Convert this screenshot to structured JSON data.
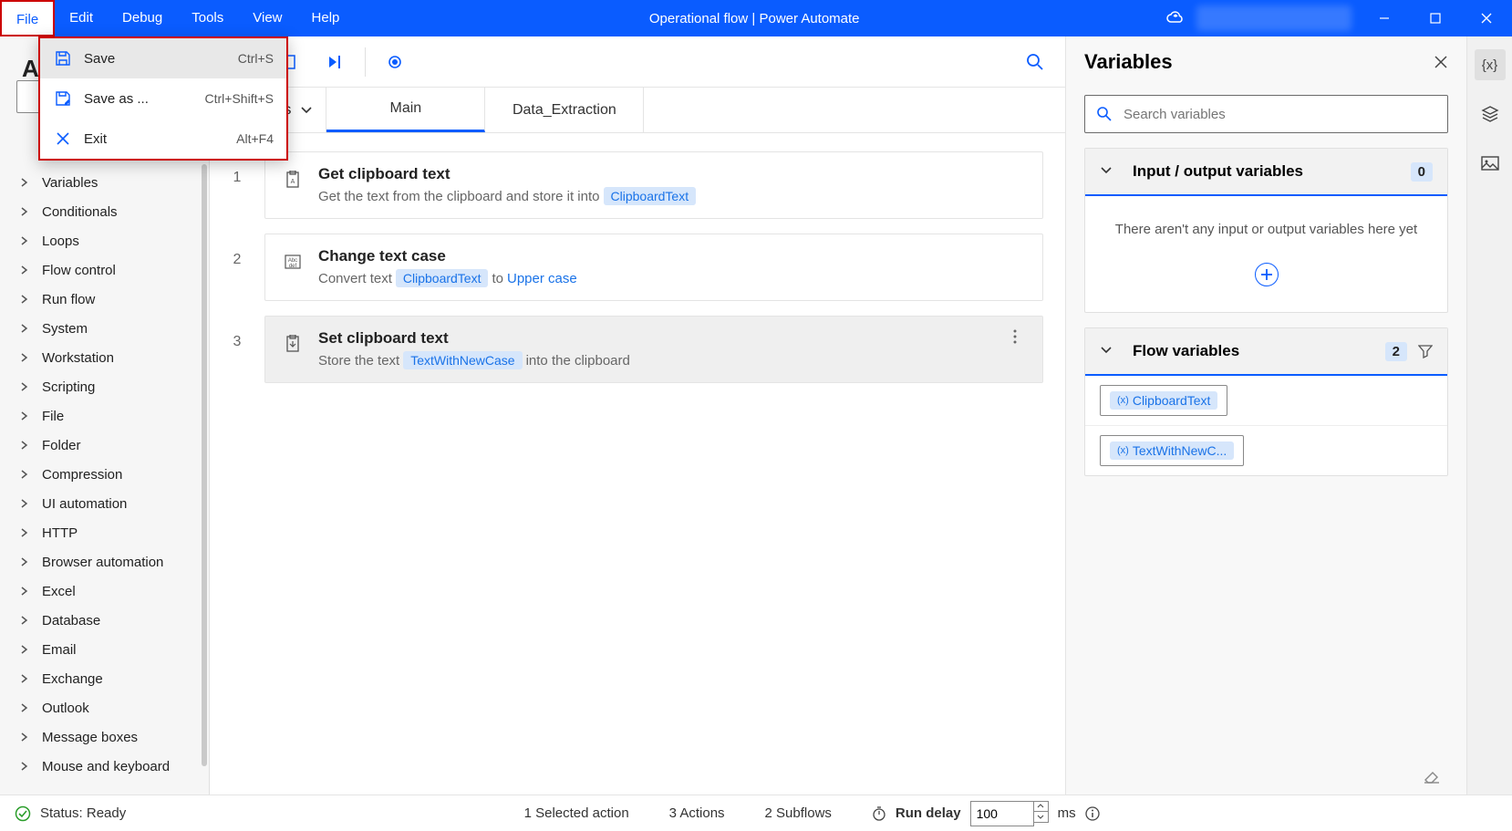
{
  "titlebar": {
    "menu": [
      "File",
      "Edit",
      "Debug",
      "Tools",
      "View",
      "Help"
    ],
    "title": "Operational flow | Power Automate"
  },
  "file_menu": {
    "items": [
      {
        "label": "Save",
        "shortcut": "Ctrl+S",
        "hover": true
      },
      {
        "label": "Save as ...",
        "shortcut": "Ctrl+Shift+S",
        "hover": false
      },
      {
        "label": "Exit",
        "shortcut": "Alt+F4",
        "hover": false
      }
    ]
  },
  "actions_pane": {
    "header_partial": "A",
    "tree": [
      "Variables",
      "Conditionals",
      "Loops",
      "Flow control",
      "Run flow",
      "System",
      "Workstation",
      "Scripting",
      "File",
      "Folder",
      "Compression",
      "UI automation",
      "HTTP",
      "Browser automation",
      "Excel",
      "Database",
      "Email",
      "Exchange",
      "Outlook",
      "Message boxes",
      "Mouse and keyboard"
    ]
  },
  "tabs": {
    "subflows_label": "bflows",
    "items": [
      "Main",
      "Data_Extraction"
    ],
    "active": 0
  },
  "steps": [
    {
      "title": "Get clipboard text",
      "desc_prefix": "Get the text from the clipboard and store it into",
      "var": "ClipboardText"
    },
    {
      "title": "Change text case",
      "desc_prefix": "Convert text",
      "var": "ClipboardText",
      "mid": "to",
      "link": "Upper case"
    },
    {
      "title": "Set clipboard text",
      "desc_prefix": "Store the text",
      "var": "TextWithNewCase",
      "suffix": "into the clipboard",
      "selected": true
    }
  ],
  "variables_pane": {
    "title": "Variables",
    "search_placeholder": "Search variables",
    "io_section": {
      "label": "Input / output variables",
      "count": "0",
      "empty": "There aren't any input or output variables here yet"
    },
    "flow_section": {
      "label": "Flow variables",
      "count": "2",
      "vars": [
        "ClipboardText",
        "TextWithNewC..."
      ]
    }
  },
  "status": {
    "ready": "Status: Ready",
    "selected": "1 Selected action",
    "actions": "3 Actions",
    "subflows": "2 Subflows",
    "run_delay": "Run delay",
    "delay_value": "100",
    "ms": "ms"
  }
}
